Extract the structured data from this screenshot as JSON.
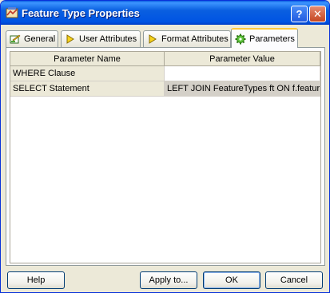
{
  "window": {
    "title": "Feature Type Properties",
    "help_symbol": "?",
    "close_symbol": "✕"
  },
  "tabs": [
    {
      "label": "General",
      "icon": "pencil-page-icon"
    },
    {
      "label": "User Attributes",
      "icon": "diamond-arrow-icon"
    },
    {
      "label": "Format Attributes",
      "icon": "diamond-arrow-icon"
    },
    {
      "label": "Parameters",
      "icon": "gear-icon",
      "active": true
    }
  ],
  "grid": {
    "columns": [
      "Parameter Name",
      "Parameter Value"
    ],
    "rows": [
      {
        "name": "WHERE Clause",
        "value": ""
      },
      {
        "name": "SELECT Statement",
        "value": "LEFT JOIN FeatureTypes ft ON f.feature"
      }
    ]
  },
  "buttons": {
    "help": "Help",
    "apply": "Apply to...",
    "ok": "OK",
    "cancel": "Cancel"
  },
  "colors": {
    "titlebar": "#0054e3",
    "active_tab_accent": "#ffc83c",
    "button_border": "#003c74"
  }
}
